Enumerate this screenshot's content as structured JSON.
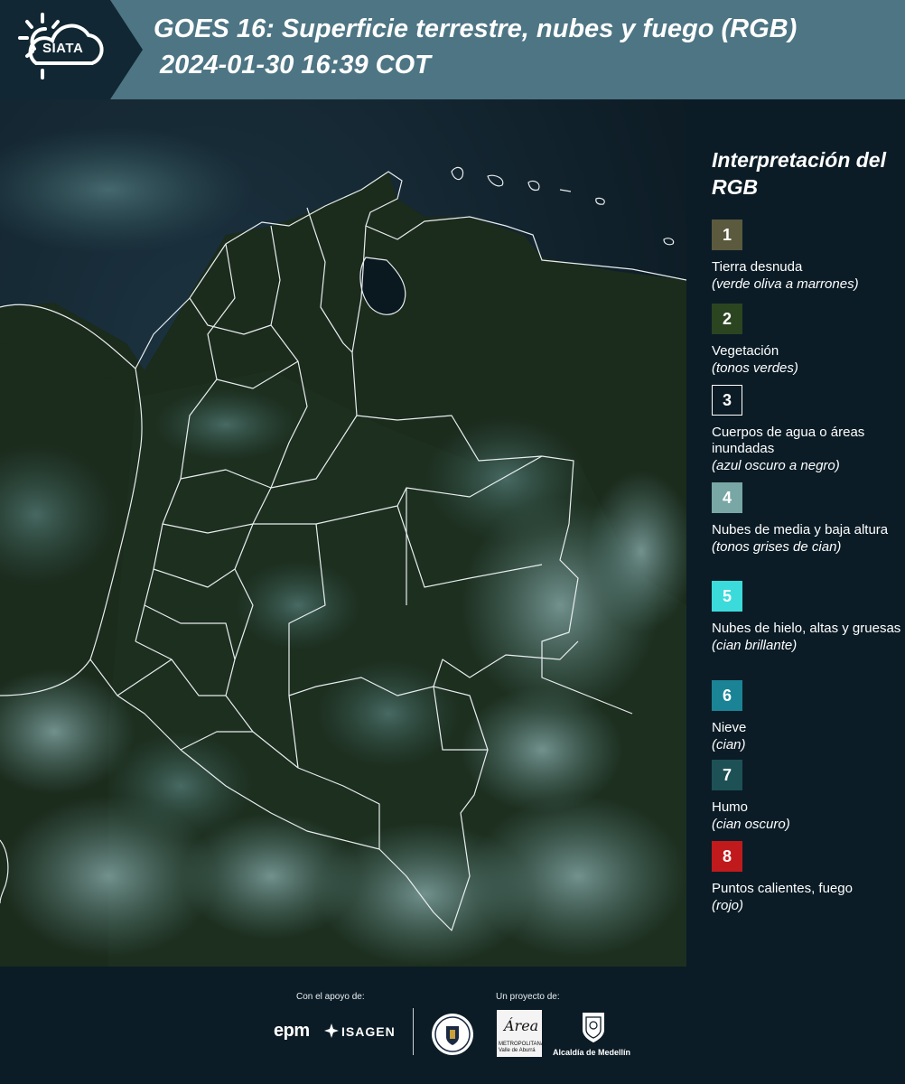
{
  "header": {
    "logo_text": "SIATA",
    "title_line1": "GOES 16: Superficie terrestre, nubes y fuego (RGB)",
    "title_line2": "2024-01-30 16:39 COT"
  },
  "legend": {
    "title": "Interpretación del RGB",
    "items": [
      {
        "number": "1",
        "name": "Tierra desnuda",
        "desc": "(verde oliva a marrones)",
        "color": "#5b5a3e"
      },
      {
        "number": "2",
        "name": "Vegetación",
        "desc": "(tonos verdes)",
        "color": "#2b4521"
      },
      {
        "number": "3",
        "name": "Cuerpos de agua o áreas inundadas",
        "desc": "(azul oscuro a negro)",
        "color": "#0b1c26"
      },
      {
        "number": "4",
        "name": "Nubes de media y baja altura",
        "desc": "(tonos grises de cian)",
        "color": "#78a7a5"
      },
      {
        "number": "5",
        "name": "Nubes de hielo, altas y gruesas",
        "desc": "(cian brillante)",
        "color": "#3bdbdb"
      },
      {
        "number": "6",
        "name": "Nieve",
        "desc": "(cian)",
        "color": "#1a8496"
      },
      {
        "number": "7",
        "name": "Humo",
        "desc": "(cian oscuro)",
        "color": "#1d5156"
      },
      {
        "number": "8",
        "name": "Puntos calientes, fuego",
        "desc": "(rojo)",
        "color": "#c01a1d"
      }
    ]
  },
  "footer": {
    "support_label": "Con el apoyo de:",
    "project_label": "Un proyecto de:",
    "epm_logo": "epm",
    "isagen_logo": "ISAGEN",
    "area_logo_word": "Área",
    "area_logo_sub": "METROPOLITANA Valle de Aburrá",
    "alcaldia_label": "Alcaldía de Medellín"
  },
  "colors": {
    "header_bg": "#4d7584",
    "panel_bg": "#0b1c26",
    "vegetation": "#1e2e1c",
    "clouds": "#5f8c8c"
  }
}
